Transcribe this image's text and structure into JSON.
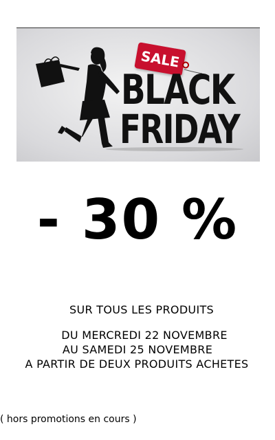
{
  "banner": {
    "sale_tag": "SALE",
    "title_line1": "BLACK",
    "title_line2": "FRIDAY",
    "tag_color": "#c8102e",
    "figure_icon": "shopping-woman-silhouette-icon"
  },
  "promo": {
    "discount": "- 30 %",
    "scope": "SUR TOUS LES PRODUITS",
    "date_from": "DU MERCREDI 22 NOVEMBRE",
    "date_to": "AU SAMEDI 25 NOVEMBRE",
    "condition": "A PARTIR DE DEUX PRODUITS ACHETES",
    "footnote": "( hors promotions en cours )"
  }
}
